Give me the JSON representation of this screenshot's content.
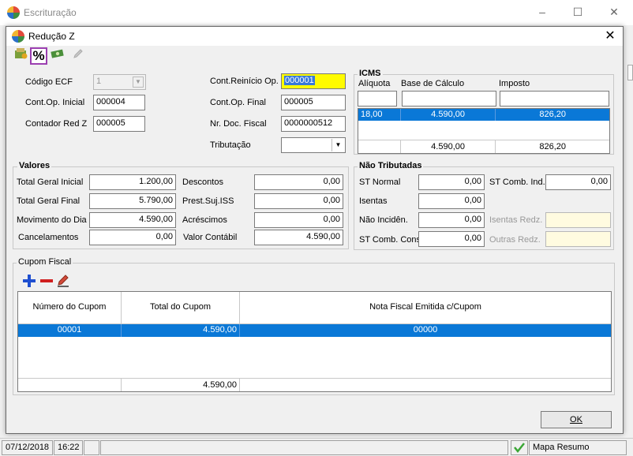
{
  "outer": {
    "title": "Escrituração"
  },
  "dialog": {
    "title": "Redução Z",
    "toolbar": {
      "percent": "%"
    },
    "fields": {
      "codigo_ecf": {
        "label": "Código ECF",
        "value": "1"
      },
      "cont_op_inicial": {
        "label": "Cont.Op. Inicial",
        "value": "000004"
      },
      "contador_red_z": {
        "label": "Contador Red Z",
        "value": "000005"
      },
      "cont_reinicio_op": {
        "label": "Cont.Reinício Op.",
        "value": "000001"
      },
      "cont_op_final": {
        "label": "Cont.Op. Final",
        "value": "000005"
      },
      "nr_doc_fiscal": {
        "label": "Nr. Doc. Fiscal",
        "value": "0000000512"
      },
      "tributacao": {
        "label": "Tributação",
        "value": ""
      }
    },
    "icms": {
      "title": "ICMS",
      "col_aliquota": "Alíquota",
      "col_base": "Base de Cálculo",
      "col_imposto": "Imposto",
      "row": {
        "aliquota": "18,00",
        "base": "4.590,00",
        "imposto": "826,20"
      },
      "total": {
        "base": "4.590,00",
        "imposto": "826,20"
      }
    },
    "valores": {
      "title": "Valores",
      "total_geral_inicial": {
        "label": "Total Geral Inicial",
        "value": "1.200,00"
      },
      "total_geral_final": {
        "label": "Total Geral Final",
        "value": "5.790,00"
      },
      "movimento_do_dia": {
        "label": "Movimento do Dia",
        "value": "4.590,00"
      },
      "cancelamentos": {
        "label": "Cancelamentos",
        "value": "0,00"
      },
      "descontos": {
        "label": "Descontos",
        "value": "0,00"
      },
      "prest_suj_iss": {
        "label": "Prest.Suj.ISS",
        "value": "0,00"
      },
      "acrescimos": {
        "label": "Acréscimos",
        "value": "0,00"
      },
      "valor_contabil": {
        "label": "Valor Contábil",
        "value": "4.590,00"
      }
    },
    "nao_tributadas": {
      "title": "Não Tributadas",
      "st_normal": {
        "label": "ST Normal",
        "value": "0,00"
      },
      "isentas": {
        "label": "Isentas",
        "value": "0,00"
      },
      "nao_incidencia": {
        "label": "Não Incidên.",
        "value": "0,00"
      },
      "st_comb_cons": {
        "label": "ST Comb. Cons",
        "value": "0,00"
      },
      "st_comb_ind": {
        "label": "ST Comb. Ind.",
        "value": "0,00"
      },
      "isentas_redz": {
        "label": "Isentas Redz.",
        "value": ""
      },
      "outras_redz": {
        "label": "Outras Redz.",
        "value": ""
      }
    },
    "cupom": {
      "title": "Cupom Fiscal",
      "columns": [
        "Número do Cupom",
        "Total do Cupom",
        "Nota Fiscal Emitida c/Cupom"
      ],
      "rows": [
        {
          "numero": "00001",
          "total": "4.590,00",
          "nota": "00000"
        }
      ],
      "total": "4.590,00"
    },
    "ok_label": "OK"
  },
  "status": {
    "date": "07/12/2018",
    "time": "16:22",
    "mapa": "Mapa Resumo"
  }
}
